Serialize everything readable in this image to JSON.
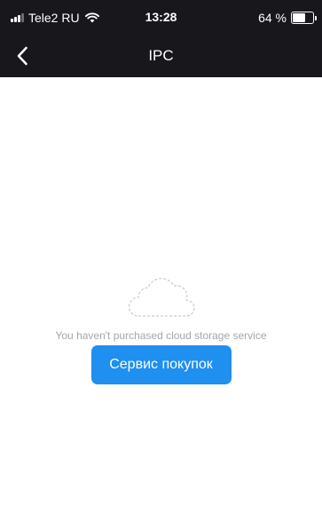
{
  "status_bar": {
    "carrier": "Tele2 RU",
    "time": "13:28",
    "battery_percent": "64 %",
    "battery_level": 0.64,
    "signal_bars": 3,
    "signal_bars_total": 4
  },
  "nav": {
    "title": "IPC",
    "back_icon": "chevron-left-icon"
  },
  "empty_state": {
    "icon": "cloud-outline-icon",
    "message": "You haven't purchased cloud storage service",
    "button_label": "Сервис покупок"
  },
  "colors": {
    "header_bg": "#17171c",
    "button_bg": "#1f8ff0",
    "message_text": "#a6a6a6",
    "cloud_outline": "#bfbfbf"
  }
}
